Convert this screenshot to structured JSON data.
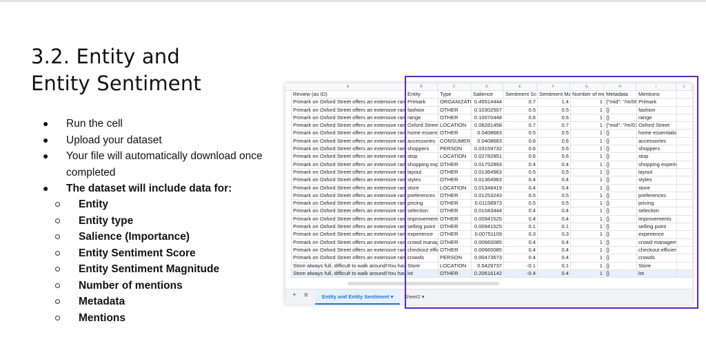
{
  "slide": {
    "title_line1": "3.2. Entity and",
    "title_line2": "Entity Sentiment",
    "bullets": [
      "Run the cell",
      "Upload your dataset",
      "Your file will automatically download once completed",
      "The dataset will include data for:"
    ],
    "sub_bullets": [
      "Entity",
      "Entity type",
      "Salience (Importance)",
      "Entity Sentiment Score",
      "Entity Sentiment Magnitude",
      "Number of mentions",
      "Metadata",
      "Mentions"
    ]
  },
  "sheet": {
    "column_letters": [
      "A",
      "B",
      "C",
      "D",
      "E",
      "F",
      "G",
      "H",
      "I",
      "J"
    ],
    "headers": [
      "Review (as ID)",
      "Entity",
      "Type",
      "Salience",
      "Sentiment Sc",
      "Sentiment Ma",
      "Number of me",
      "Metadata",
      "Mentions",
      ""
    ],
    "rows": [
      [
        "Primark on Oxford Street offers an extensive ran",
        "Primark",
        "ORGANIZATI",
        "0.45514444",
        "0.7",
        "1.4",
        "1",
        "{\"mid\": \"/m/06",
        "Primark",
        ""
      ],
      [
        "Primark on Oxford Street offers an extensive ran",
        "fashion",
        "OTHER",
        "0.10302507",
        "0.5",
        "0.5",
        "1",
        "{}",
        "fashion",
        ""
      ],
      [
        "Primark on Oxford Street offers an extensive ran",
        "range",
        "OTHER",
        "0.10070448",
        "0.6",
        "0.6",
        "1",
        "{}",
        "range",
        ""
      ],
      [
        "Primark on Oxford Street offers an extensive ran",
        "Oxford Street",
        "LOCATION",
        "0.06281458",
        "0.7",
        "0.7",
        "1",
        "{\"mid\": \"/m/01",
        "Oxford Street",
        ""
      ],
      [
        "Primark on Oxford Street offers an extensive ran",
        "home essenti",
        "OTHER",
        "0.0408683",
        "0.5",
        "0.5",
        "1",
        "{}",
        "home essentials",
        ""
      ],
      [
        "Primark on Oxford Street offers an extensive ran",
        "accessories",
        "CONSUMER_",
        "0.0408683",
        "0.6",
        "0.6",
        "1",
        "{}",
        "accessories",
        ""
      ],
      [
        "Primark on Oxford Street offers an extensive ran",
        "shoppers",
        "PERSON",
        "0.03159732",
        "0.6",
        "0.6",
        "1",
        "{}",
        "shoppers",
        ""
      ],
      [
        "Primark on Oxford Street offers an extensive ran",
        "stop",
        "LOCATION",
        "0.02782851",
        "0.6",
        "0.6",
        "1",
        "{}",
        "stop",
        ""
      ],
      [
        "Primark on Oxford Street offers an extensive ran",
        "shopping exp",
        "OTHER",
        "0.01752893",
        "0.4",
        "0.4",
        "1",
        "{}",
        "shopping experience",
        ""
      ],
      [
        "Primark on Oxford Street offers an extensive ran",
        "layout",
        "OTHER",
        "0.01364963",
        "0.5",
        "0.5",
        "1",
        "{}",
        "layout",
        ""
      ],
      [
        "Primark on Oxford Street offers an extensive ran",
        "styles",
        "OTHER",
        "0.01364963",
        "0.4",
        "0.4",
        "1",
        "{}",
        "styles",
        ""
      ],
      [
        "Primark on Oxford Street offers an extensive ran",
        "store",
        "LOCATION",
        "0.01348419",
        "0.4",
        "0.4",
        "1",
        "{}",
        "store",
        ""
      ],
      [
        "Primark on Oxford Street offers an extensive ran",
        "preferences",
        "OTHER",
        "0.01253243",
        "0.5",
        "0.5",
        "1",
        "{}",
        "preferences",
        ""
      ],
      [
        "Primark on Oxford Street offers an extensive ran",
        "pricing",
        "OTHER",
        "0.01158973",
        "0.5",
        "0.5",
        "1",
        "{}",
        "pricing",
        ""
      ],
      [
        "Primark on Oxford Street offers an extensive ran",
        "selection",
        "OTHER",
        "0.01043444",
        "0.4",
        "0.4",
        "1",
        "{}",
        "selection",
        ""
      ],
      [
        "Primark on Oxford Street offers an extensive ran",
        "improvements",
        "OTHER",
        "0.00941525",
        "0.4",
        "0.4",
        "1",
        "{}",
        "improvements",
        ""
      ],
      [
        "Primark on Oxford Street offers an extensive ran",
        "selling point",
        "OTHER",
        "0.00941525",
        "0.1",
        "0.1",
        "1",
        "{}",
        "selling point",
        ""
      ],
      [
        "Primark on Oxford Street offers an extensive ran",
        "experience",
        "OTHER",
        "0.00751109",
        "0.3",
        "0.3",
        "1",
        "{}",
        "experience",
        ""
      ],
      [
        "Primark on Oxford Street offers an extensive ran",
        "crowd manag",
        "OTHER",
        "0.00660085",
        "0.4",
        "0.4",
        "1",
        "{}",
        "crowd management",
        ""
      ],
      [
        "Primark on Oxford Street offers an extensive ran",
        "checkout effic",
        "OTHER",
        "0.00660085",
        "0.4",
        "0.4",
        "1",
        "{}",
        "checkout efficiency",
        ""
      ],
      [
        "Primark on Oxford Street offers an extensive ran",
        "crowds",
        "PERSON",
        "0.00473673",
        "0.4",
        "0.4",
        "1",
        "{}",
        "crowds",
        ""
      ],
      [
        "Store always full, difficult to walk around!You hav",
        "Store",
        "LOCATION",
        "0.5429737",
        "-0.1",
        "0.1",
        "1",
        "{}",
        "Store",
        ""
      ],
      [
        "Store always full, difficult to walk around!You hav",
        "lot",
        "OTHER",
        "0.20616142",
        "-0.4",
        "0.4",
        "1",
        "{}",
        "lot",
        ""
      ]
    ],
    "tabs": {
      "active": "Entity and Entity Sentiment",
      "other": "Sheet2"
    },
    "accent": "#5b22c9"
  }
}
